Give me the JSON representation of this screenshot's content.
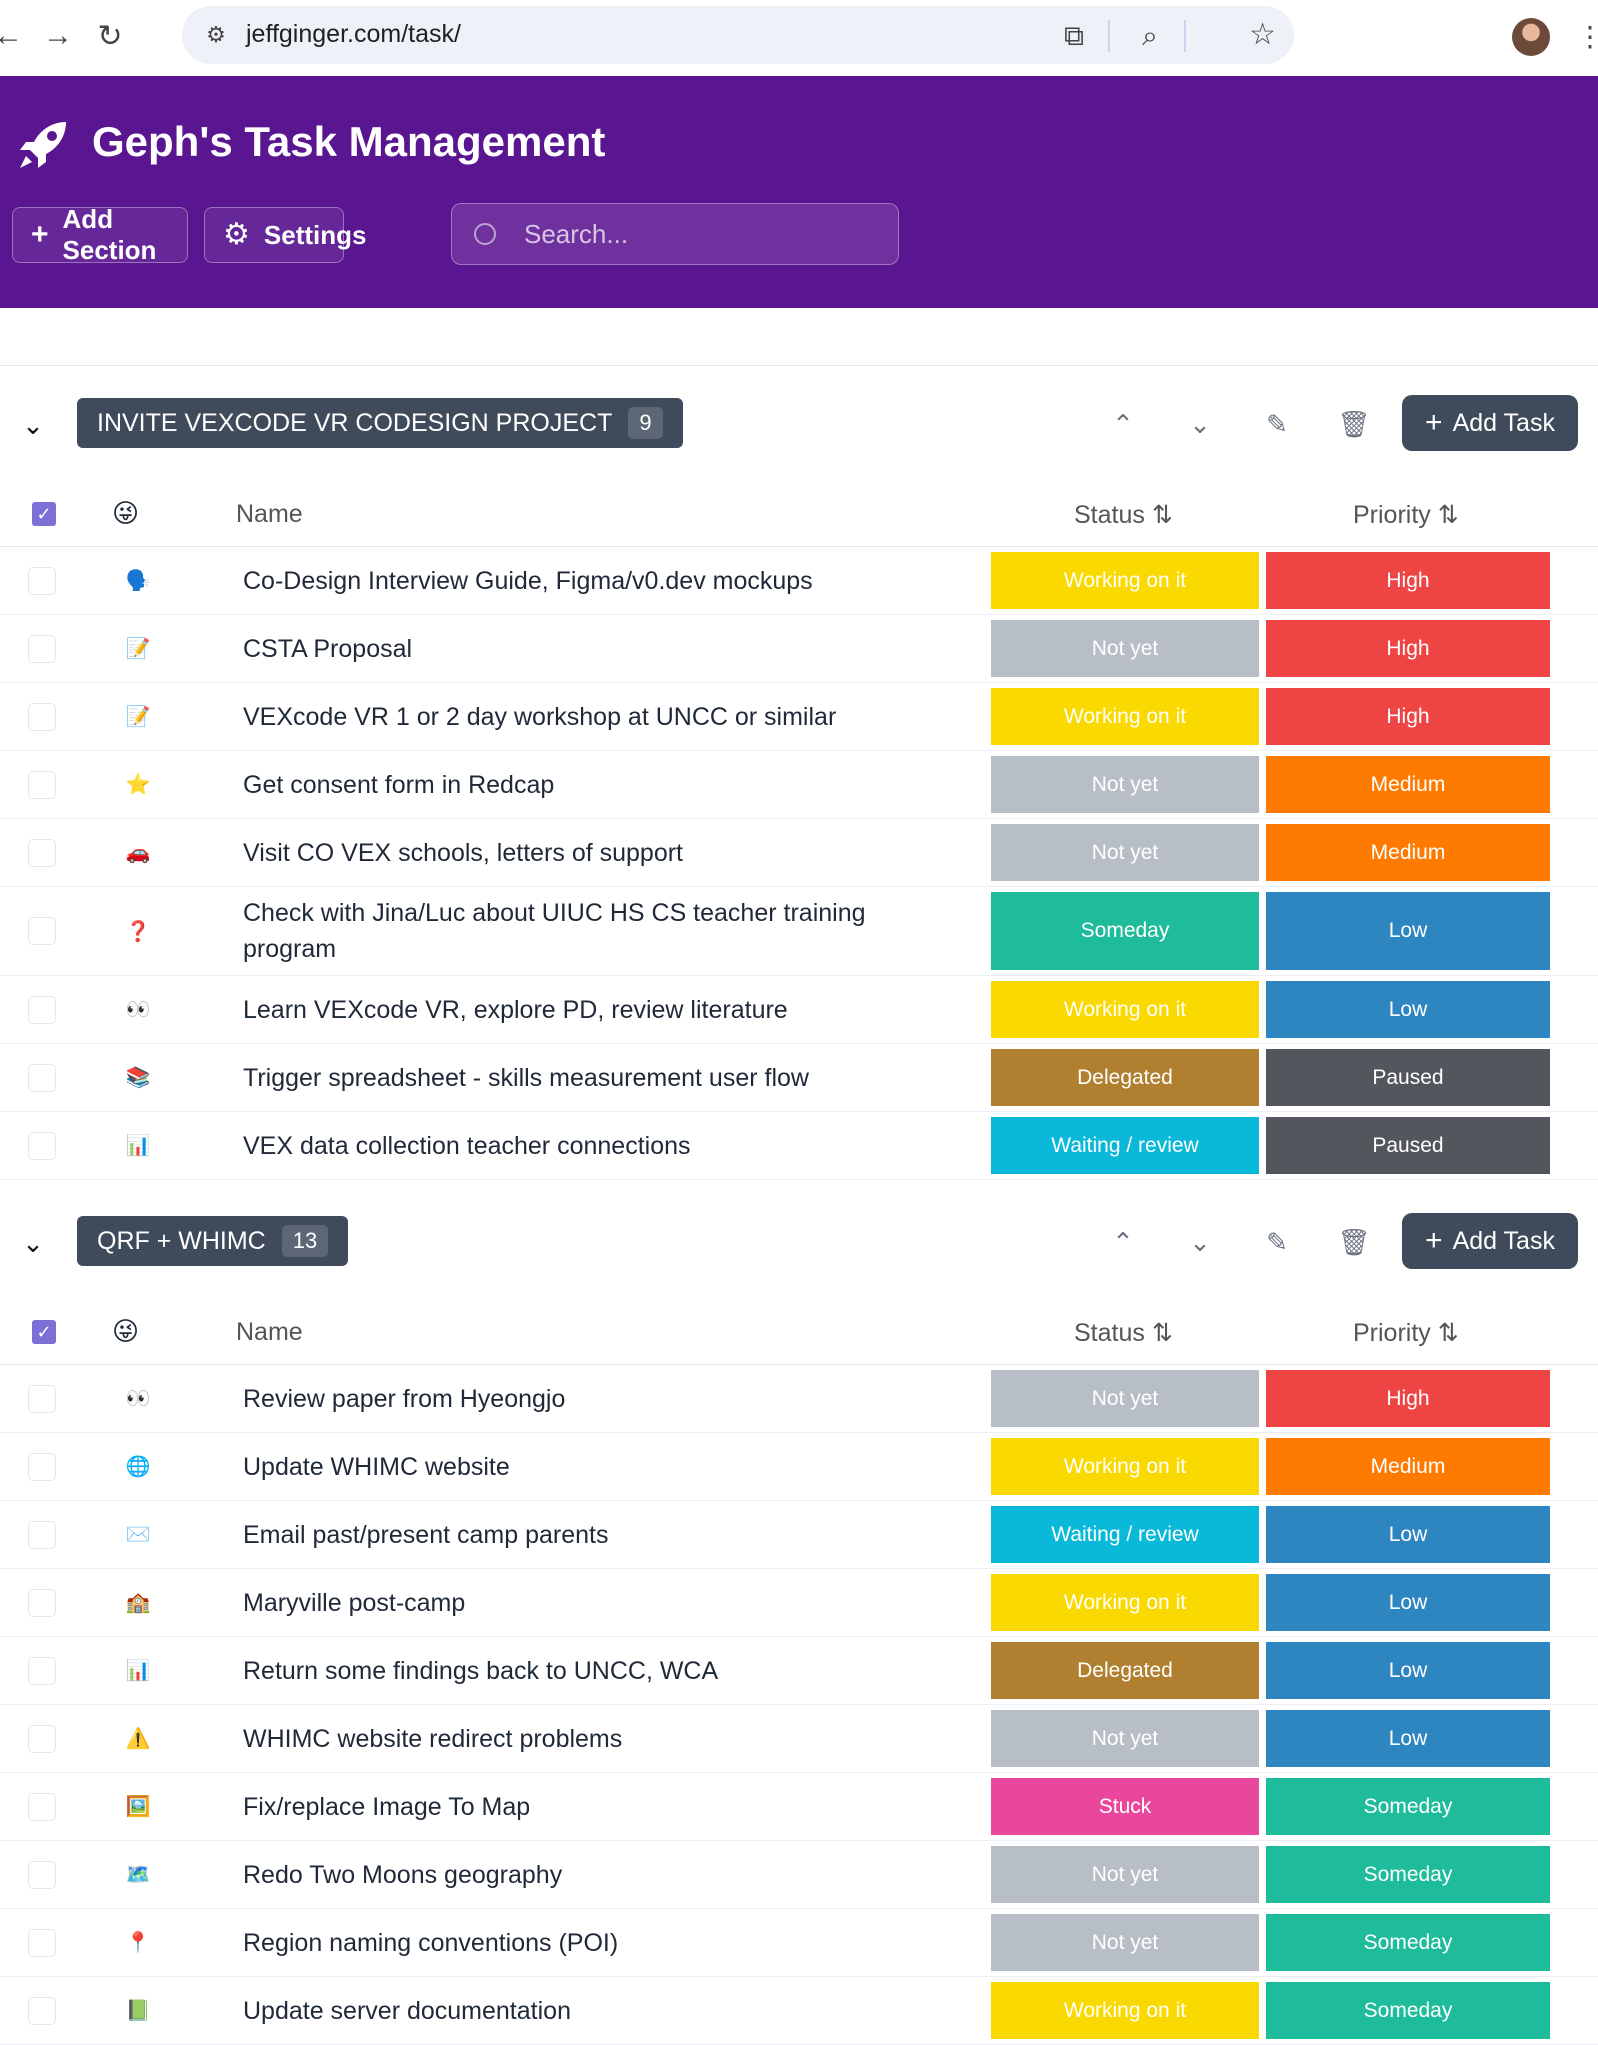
{
  "browser": {
    "url": "jeffginger.com/task/"
  },
  "header": {
    "title": "Geph's Task Management",
    "add_section_label": "Add Section",
    "settings_label": "Settings",
    "search_placeholder": "Search..."
  },
  "columns": {
    "name": "Name",
    "status": "Status ⇅",
    "priority": "Priority ⇅"
  },
  "colors": {
    "header_bg": "#5a1590",
    "Working on it": "#fad901",
    "Not yet": "#b8bec6",
    "Someday": "#1fbc9c",
    "Delegated": "#b07f2f",
    "Waiting / review": "#0ab9d9",
    "Stuck": "#e8479b",
    "High": "#ef4444",
    "Medium": "#ff7a00",
    "Low": "#2e86c1",
    "Paused": "#53565c"
  },
  "sections": [
    {
      "title": "INVITE VEXCODE VR CODESIGN PROJECT",
      "count": "9",
      "add_task_label": "Add Task",
      "tasks": [
        {
          "emoji": "🗣️",
          "name": "Co-Design Interview Guide, Figma/v0.dev mockups",
          "status": "Working on it",
          "priority": "High"
        },
        {
          "emoji": "📝",
          "name": "CSTA Proposal",
          "status": "Not yet",
          "priority": "High"
        },
        {
          "emoji": "📝",
          "name": "VEXcode VR 1 or 2 day workshop at UNCC or similar",
          "status": "Working on it",
          "priority": "High"
        },
        {
          "emoji": "⭐",
          "name": "Get consent form in Redcap",
          "status": "Not yet",
          "priority": "Medium"
        },
        {
          "emoji": "🚗",
          "name": "Visit CO VEX schools, letters of support",
          "status": "Not yet",
          "priority": "Medium"
        },
        {
          "emoji": "❓",
          "name": "Check with Jina/Luc about UIUC HS CS teacher training program",
          "status": "Someday",
          "priority": "Low"
        },
        {
          "emoji": "👀",
          "name": "Learn VEXcode VR, explore PD, review literature",
          "status": "Working on it",
          "priority": "Low"
        },
        {
          "emoji": "📚",
          "name": "Trigger spreadsheet - skills measurement user flow",
          "status": "Delegated",
          "priority": "Paused"
        },
        {
          "emoji": "📊",
          "name": "VEX data collection teacher connections",
          "status": "Waiting / review",
          "priority": "Paused"
        }
      ]
    },
    {
      "title": "QRF + WHIMC",
      "count": "13",
      "add_task_label": "Add Task",
      "tasks": [
        {
          "emoji": "👀",
          "name": "Review paper from Hyeongjo",
          "status": "Not yet",
          "priority": "High"
        },
        {
          "emoji": "🌐",
          "name": "Update WHIMC website",
          "status": "Working on it",
          "priority": "Medium"
        },
        {
          "emoji": "✉️",
          "name": "Email past/present camp parents",
          "status": "Waiting / review",
          "priority": "Low"
        },
        {
          "emoji": "🏫",
          "name": "Maryville post-camp",
          "status": "Working on it",
          "priority": "Low"
        },
        {
          "emoji": "📊",
          "name": "Return some findings back to UNCC, WCA",
          "status": "Delegated",
          "priority": "Low"
        },
        {
          "emoji": "⚠️",
          "name": "WHIMC website redirect problems",
          "status": "Not yet",
          "priority": "Low"
        },
        {
          "emoji": "🖼️",
          "name": "Fix/replace Image To Map",
          "status": "Stuck",
          "priority": "Someday"
        },
        {
          "emoji": "🗺️",
          "name": "Redo Two Moons geography",
          "status": "Not yet",
          "priority": "Someday"
        },
        {
          "emoji": "📍",
          "name": "Region naming conventions (POI)",
          "status": "Not yet",
          "priority": "Someday"
        },
        {
          "emoji": "📗",
          "name": "Update server documentation",
          "status": "Working on it",
          "priority": "Someday"
        }
      ]
    }
  ]
}
